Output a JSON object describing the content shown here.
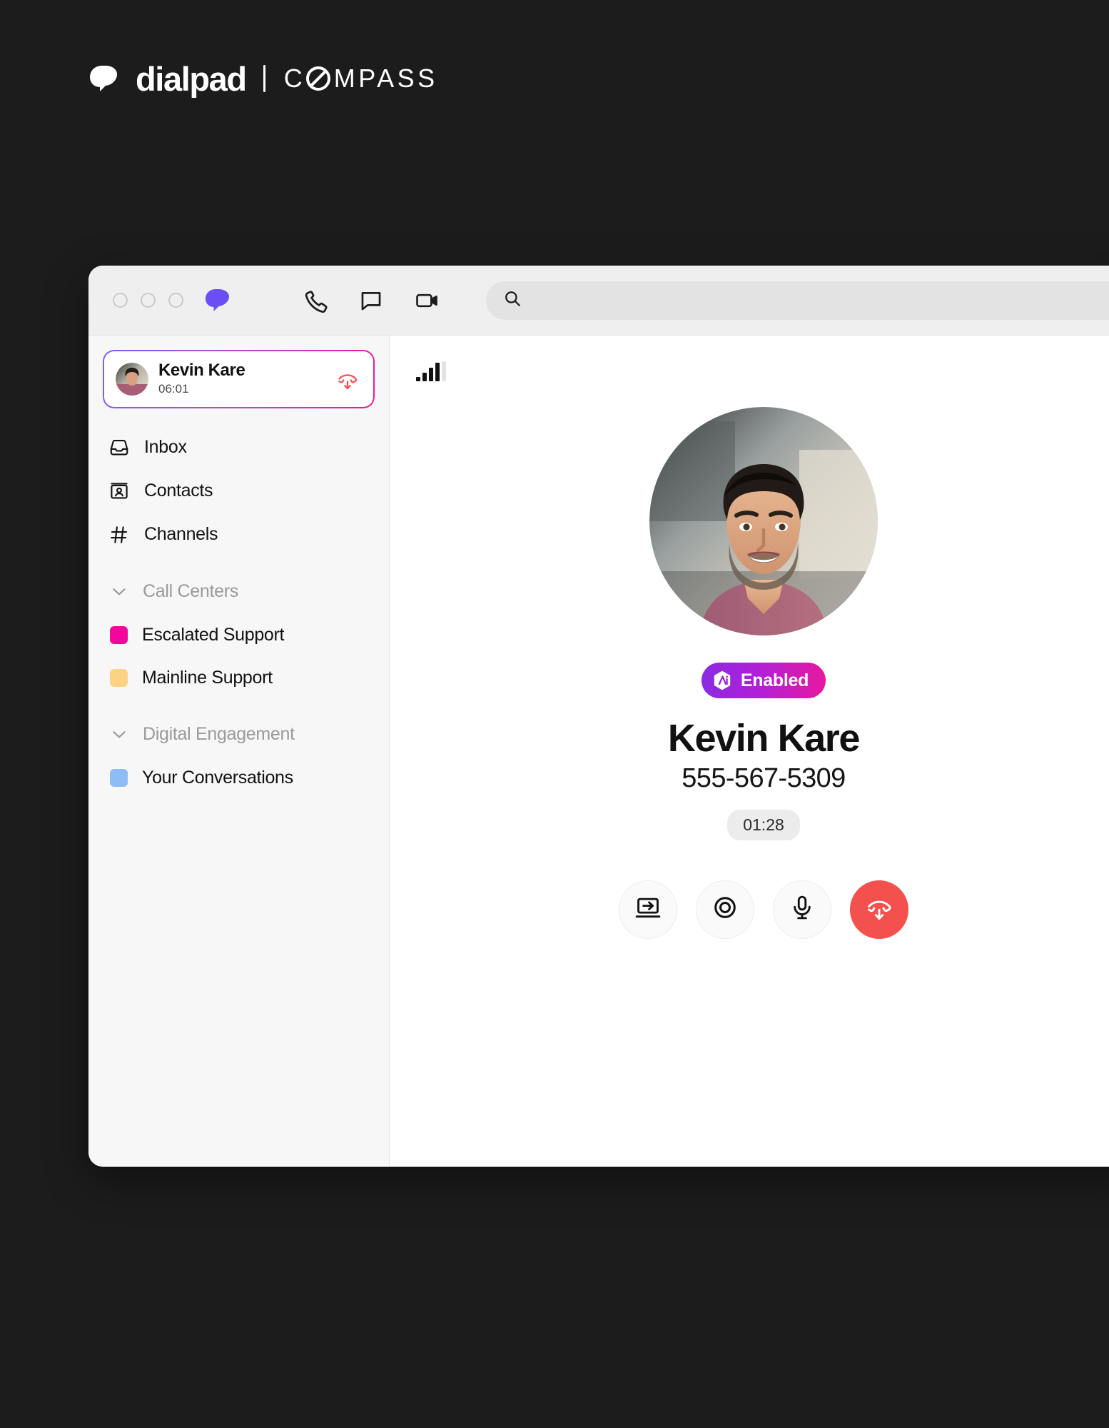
{
  "brand": {
    "mark_icon": "dialpad-logo-icon",
    "wordmark": "dialpad",
    "divider": "|",
    "product_pre": "C",
    "product_post": "MPASS",
    "product_full": "COMPASS"
  },
  "window": {
    "titlebar": {
      "traffic_lights": [
        "close",
        "minimize",
        "maximize"
      ],
      "app_logo_icon": "dialpad-logo-icon",
      "actions": [
        {
          "name": "phone-icon",
          "label": "Call"
        },
        {
          "name": "chat-icon",
          "label": "Messages"
        },
        {
          "name": "video-icon",
          "label": "Video"
        }
      ],
      "search": {
        "icon": "search-icon",
        "value": "",
        "placeholder": ""
      }
    }
  },
  "sidebar": {
    "active_call": {
      "avatar": "contact-avatar",
      "name": "Kevin Kare",
      "duration": "06:01",
      "end_call_icon": "hangup-icon"
    },
    "nav": [
      {
        "icon": "inbox-icon",
        "label": "Inbox"
      },
      {
        "icon": "contacts-icon",
        "label": "Contacts"
      },
      {
        "icon": "hash-icon",
        "label": "Channels"
      }
    ],
    "groups": [
      {
        "chevron_icon": "chevron-down-icon",
        "label": "Call Centers",
        "items": [
          {
            "label": "Escalated Support",
            "color": "#F2069B"
          },
          {
            "label": "Mainline Support",
            "color": "#FBD382"
          }
        ]
      },
      {
        "chevron_icon": "chevron-down-icon",
        "label": "Digital Engagement",
        "items": [
          {
            "label": "Your Conversations",
            "color": "#8EBDF5"
          }
        ]
      }
    ]
  },
  "main": {
    "signal_icon": "signal-strength-icon",
    "signal_bars_filled": 4,
    "signal_bars_total": 5,
    "avatar": "caller-photo",
    "ai_badge": {
      "icon": "ai-hexagon-icon",
      "label": "Enabled",
      "gradient_from": "#8A2BE2",
      "gradient_to": "#E8189F"
    },
    "caller_name": "Kevin Kare",
    "caller_number": "555-567-5309",
    "call_duration": "01:28",
    "controls": [
      {
        "name": "transfer-button",
        "icon": "transfer-icon",
        "label": "Transfer"
      },
      {
        "name": "record-button",
        "icon": "record-icon",
        "label": "Record"
      },
      {
        "name": "mute-button",
        "icon": "microphone-icon",
        "label": "Mute"
      },
      {
        "name": "hangup-button",
        "icon": "hangup-icon",
        "label": "End call",
        "color": "#F4504E"
      }
    ]
  }
}
